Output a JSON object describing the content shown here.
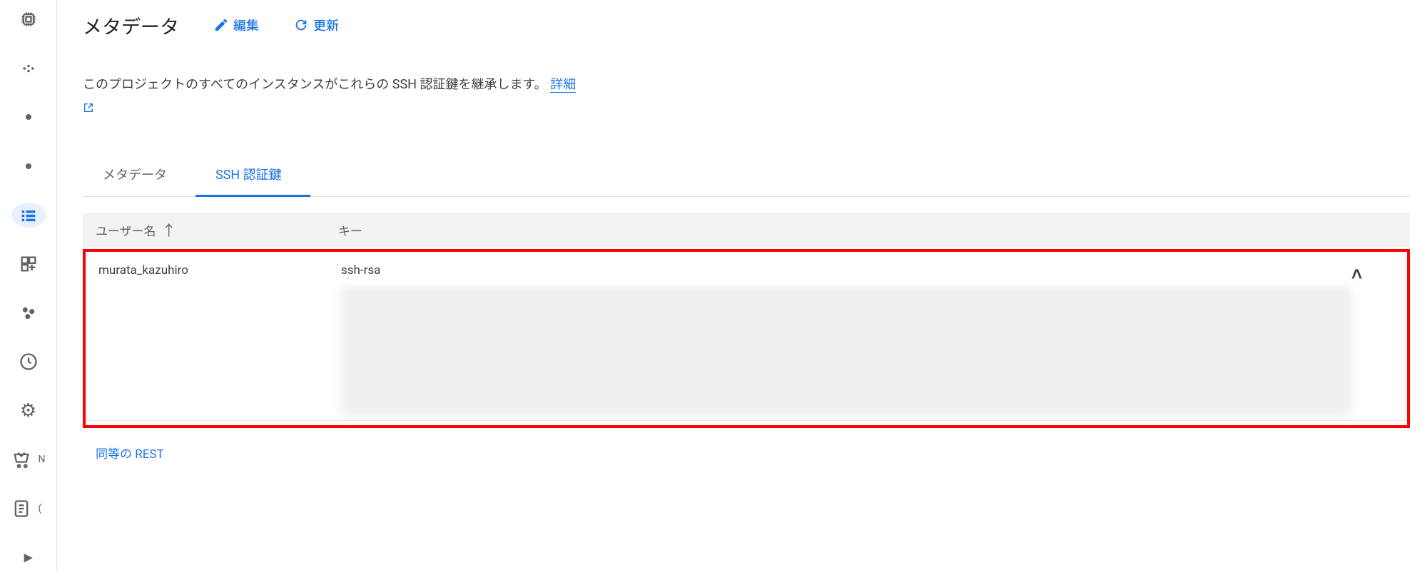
{
  "header": {
    "title": "メタデータ",
    "edit_label": "編集",
    "refresh_label": "更新"
  },
  "description": {
    "text": "このプロジェクトのすべてのインスタンスがこれらの SSH 認証鍵を継承します。 ",
    "link_label": "詳細"
  },
  "tabs": [
    {
      "label": "メタデータ",
      "active": false
    },
    {
      "label": "SSH 認証鍵",
      "active": true
    }
  ],
  "columns": {
    "user": "ユーザー名",
    "key": "キー"
  },
  "rows": [
    {
      "user": "murata_kazuhiro",
      "key_type": "ssh-rsa"
    }
  ],
  "footer": {
    "rest_link": "同等の REST"
  },
  "sidebar": {
    "items": [
      {
        "name": "cpu-icon"
      },
      {
        "name": "dots-icon"
      },
      {
        "name": "dot-icon-1"
      },
      {
        "name": "dot-icon-2"
      },
      {
        "name": "metadata-icon",
        "active": true
      },
      {
        "name": "grid-icon"
      },
      {
        "name": "cluster-icon"
      },
      {
        "name": "clock-icon"
      },
      {
        "name": "gear-icon"
      },
      {
        "name": "cart-icon"
      },
      {
        "name": "doc-icon"
      },
      {
        "name": "expand-icon"
      }
    ],
    "cart_suffix": "N",
    "doc_suffix": "("
  }
}
